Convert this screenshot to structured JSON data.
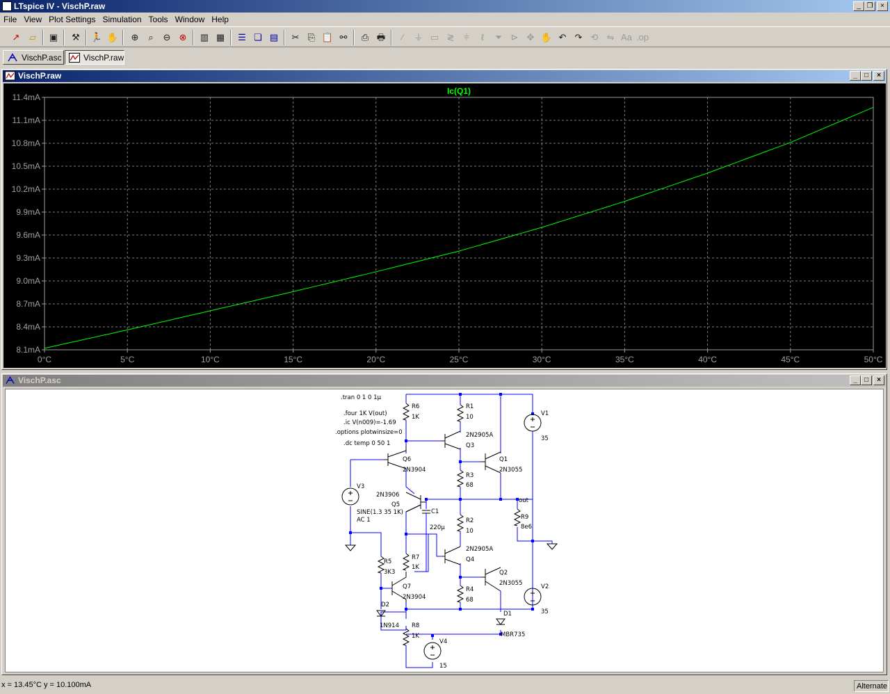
{
  "app": {
    "title": "LTspice IV - VischP.raw"
  },
  "menu": [
    "File",
    "View",
    "Plot Settings",
    "Simulation",
    "Tools",
    "Window",
    "Help"
  ],
  "tabs": [
    {
      "label": "VischP.asc"
    },
    {
      "label": "VischP.raw"
    }
  ],
  "plot_window": {
    "title": "VischP.raw"
  },
  "schematic_window": {
    "title": "VischP.asc"
  },
  "chart_data": {
    "type": "line",
    "title": "Ic(Q1)",
    "xlabel": "",
    "ylabel": "",
    "x_ticks": [
      "0°C",
      "5°C",
      "10°C",
      "15°C",
      "20°C",
      "25°C",
      "30°C",
      "35°C",
      "40°C",
      "45°C",
      "50°C"
    ],
    "y_ticks": [
      "11.4mA",
      "11.1mA",
      "10.8mA",
      "10.5mA",
      "10.2mA",
      "9.9mA",
      "9.6mA",
      "9.3mA",
      "9.0mA",
      "8.7mA",
      "8.4mA",
      "8.1mA"
    ],
    "xlim": [
      0,
      50
    ],
    "ylim": [
      8.1,
      11.4
    ],
    "grid": true,
    "background": "#000000",
    "grid_color": "#808080",
    "trace_color": "#00ff00",
    "series": [
      {
        "name": "Ic(Q1)",
        "x": [
          0,
          5,
          10,
          15,
          20,
          25,
          30,
          35,
          40,
          45,
          50
        ],
        "y": [
          8.12,
          8.36,
          8.61,
          8.86,
          9.12,
          9.39,
          9.7,
          10.04,
          10.41,
          10.81,
          11.27
        ]
      }
    ]
  },
  "schematic": {
    "directives": [
      ".tran 0 1 0 1µ",
      ".four 1K V(out)",
      ".ic V(n009)=-1.69",
      ".options plotwinsize=0",
      ".dc temp 0 50 1"
    ],
    "labels": [
      {
        "id": "r6",
        "text": [
          "R6",
          "1K"
        ]
      },
      {
        "id": "r1",
        "text": [
          "R1",
          "10"
        ]
      },
      {
        "id": "q3",
        "text": [
          "2N2905A",
          "Q3"
        ]
      },
      {
        "id": "v1",
        "text": [
          "V1",
          "35"
        ]
      },
      {
        "id": "q6",
        "text": [
          "Q6",
          "2N3904"
        ]
      },
      {
        "id": "q1",
        "text": [
          "Q1",
          "2N3055"
        ]
      },
      {
        "id": "r3",
        "text": [
          "R3",
          "68"
        ]
      },
      {
        "id": "v3",
        "text": [
          "V3"
        ]
      },
      {
        "id": "q5",
        "text": [
          "2N3906",
          "Q5"
        ]
      },
      {
        "id": "v3val",
        "text": [
          "SINE(1.3 35 1K)",
          "AC 1"
        ]
      },
      {
        "id": "c1",
        "text": [
          "C1",
          "220µ"
        ]
      },
      {
        "id": "out",
        "text": [
          "out"
        ]
      },
      {
        "id": "r9",
        "text": [
          "R9",
          "8e6"
        ]
      },
      {
        "id": "r2",
        "text": [
          "R2",
          "10"
        ]
      },
      {
        "id": "q4",
        "text": [
          "2N2905A",
          "Q4"
        ]
      },
      {
        "id": "r5",
        "text": [
          "R5",
          "3K3"
        ]
      },
      {
        "id": "r7",
        "text": [
          "R7",
          "1K"
        ]
      },
      {
        "id": "q2",
        "text": [
          "Q2",
          "2N3055"
        ]
      },
      {
        "id": "v2",
        "text": [
          "V2",
          "35"
        ]
      },
      {
        "id": "q7",
        "text": [
          "Q7",
          "2N3904"
        ]
      },
      {
        "id": "r4",
        "text": [
          "R4",
          "68"
        ]
      },
      {
        "id": "d2",
        "text": [
          "D2",
          "1N914"
        ]
      },
      {
        "id": "d1",
        "text": [
          "D1",
          "MBR735"
        ]
      },
      {
        "id": "r8",
        "text": [
          "R8",
          "1K"
        ]
      },
      {
        "id": "v4",
        "text": [
          "V4",
          "15"
        ]
      }
    ]
  },
  "status": {
    "left": "x = 13.45°C    y = 10.100mA",
    "right": "Alternate"
  }
}
